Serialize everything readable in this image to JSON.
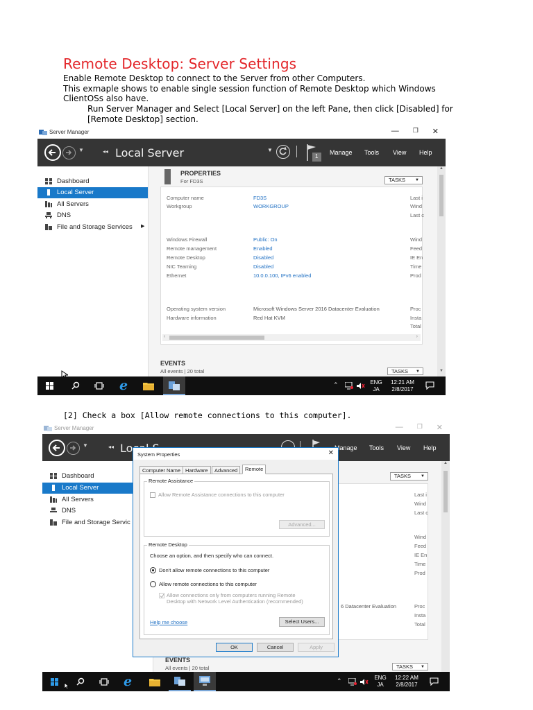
{
  "doc": {
    "title": "Remote Desktop: Server Settings",
    "line1": "Enable Remote Desktop to connect to the Server from other Computers.",
    "line2": "This exmaple shows to enable single session function of Remote Desktop which Windows",
    "line3": "ClientOSs also have.",
    "step1_line1": "Run Server Manager and Select [Local Server] on the left Pane, then click [Disabled] for",
    "step1_line2": "[Remote Desktop] section.",
    "step2": "[2]  Check a box [Allow remote connections to this computer]."
  },
  "sm1": {
    "window_title": "Server Manager",
    "nav_title": "Local Server",
    "nav_prefix": "◂◂",
    "menu": [
      "Manage",
      "Tools",
      "View",
      "Help"
    ],
    "flag_count": "1",
    "sidebar": [
      "Dashboard",
      "Local Server",
      "All Servers",
      "DNS",
      "File and Storage Services"
    ],
    "properties_title": "PROPERTIES",
    "properties_sub": "For FD3S",
    "tasks": "TASKS",
    "rows": [
      {
        "label": "Computer name",
        "value": "FD3S",
        "right": "Last i"
      },
      {
        "label": "Workgroup",
        "value": "WORKGROUP",
        "right": "Wind"
      },
      {
        "label": "",
        "value": "",
        "right": "Last c"
      },
      {
        "label": "Windows Firewall",
        "value": "Public: On",
        "right": "Wind"
      },
      {
        "label": "Remote management",
        "value": "Enabled",
        "right": "Feed"
      },
      {
        "label": "Remote Desktop",
        "value": "Disabled",
        "right": "IE En"
      },
      {
        "label": "NIC Teaming",
        "value": "Disabled",
        "right": "Time"
      },
      {
        "label": "Ethernet",
        "value": "10.0.0.100, IPv6 enabled",
        "right": "Prod"
      },
      {
        "label": "Operating system version",
        "value": "Microsoft Windows Server 2016 Datacenter Evaluation",
        "right": "Proc"
      },
      {
        "label": "Hardware information",
        "value": "Red Hat KVM",
        "right": "Insta"
      },
      {
        "label": "",
        "value": "",
        "right": "Total"
      }
    ],
    "events_title": "EVENTS",
    "events_sub": "All events | 20 total",
    "clock_lang1": "ENG",
    "clock_lang2": "JA",
    "clock_time": "12:21 AM",
    "clock_date": "2/8/2017"
  },
  "sm2": {
    "window_title": "Server Manager",
    "nav_title_partial": "Local S",
    "nav_prefix": "◂◂",
    "menu": [
      "Manage",
      "Tools",
      "View",
      "Help"
    ],
    "sidebar": [
      "Dashboard",
      "Local Server",
      "All Servers",
      "DNS",
      "File and Storage Servic"
    ],
    "tasks": "TASKS",
    "right_col": [
      "Last i",
      "Wind",
      "Last c",
      "Wind",
      "Feed",
      "IE En",
      "Time",
      "Prod",
      "Proc",
      "Insta",
      "Total"
    ],
    "os_partial": "6 Datacenter Evaluation",
    "events_title": "EVENTS",
    "events_sub": "All events | 20 total",
    "clock_lang1": "ENG",
    "clock_lang2": "JA",
    "clock_time": "12:22 AM",
    "clock_date": "2/8/2017"
  },
  "dialog": {
    "title": "System Properties",
    "tabs": [
      "Computer Name",
      "Hardware",
      "Advanced",
      "Remote"
    ],
    "ra_group": "Remote Assistance",
    "ra_checkbox": "Allow Remote Assistance connections to this computer",
    "ra_advanced": "Advanced...",
    "rd_group": "Remote Desktop",
    "rd_choose": "Choose an option, and then specify who can connect.",
    "rd_opt1": "Don't allow remote connections to this computer",
    "rd_opt2": "Allow remote connections to this computer",
    "rd_nla_1": "Allow connections only from computers running Remote",
    "rd_nla_2": "Desktop with Network Level Authentication (recommended)",
    "help_link": "Help me choose",
    "select_users": "Select Users...",
    "ok": "OK",
    "cancel": "Cancel",
    "apply": "Apply"
  },
  "icons": [
    "back-arrow-icon",
    "forward-arrow-icon",
    "refresh-icon",
    "flag-icon",
    "close-icon",
    "maximize-icon",
    "minimize-icon",
    "windows-start-icon",
    "search-icon",
    "task-view-icon",
    "edge-icon",
    "file-explorer-icon",
    "server-manager-icon",
    "network-icon",
    "speaker-icon",
    "notification-icon"
  ],
  "colors": {
    "title_red": "#e3262a",
    "nav_dark": "#353535",
    "selected_blue": "#1979c9",
    "link_blue": "#1e6fc3",
    "taskbar": "#101010"
  }
}
